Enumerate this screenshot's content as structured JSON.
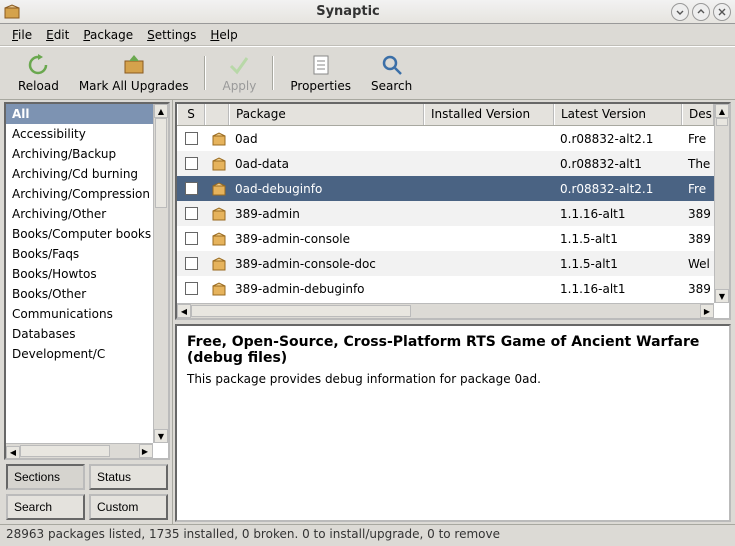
{
  "window": {
    "title": "Synaptic"
  },
  "menubar": [
    {
      "label": "File",
      "accel": "F"
    },
    {
      "label": "Edit",
      "accel": "E"
    },
    {
      "label": "Package",
      "accel": "P"
    },
    {
      "label": "Settings",
      "accel": "S"
    },
    {
      "label": "Help",
      "accel": "H"
    }
  ],
  "toolbar": {
    "reload": "Reload",
    "mark_all": "Mark All Upgrades",
    "apply": "Apply",
    "properties": "Properties",
    "search": "Search"
  },
  "categories": [
    "All",
    "Accessibility",
    "Archiving/Backup",
    "Archiving/Cd burning",
    "Archiving/Compression",
    "Archiving/Other",
    "Books/Computer books",
    "Books/Faqs",
    "Books/Howtos",
    "Books/Other",
    "Communications",
    "Databases",
    "Development/C"
  ],
  "categories_selected": 0,
  "left_buttons": {
    "sections": "Sections",
    "status": "Status",
    "search": "Search",
    "custom": "Custom"
  },
  "columns": {
    "s": "S",
    "package": "Package",
    "installed": "Installed Version",
    "latest": "Latest Version",
    "description": "Des"
  },
  "packages": [
    {
      "name": "0ad",
      "installed": "",
      "latest": "0.r08832-alt2.1",
      "desc": "Fre",
      "selected": false
    },
    {
      "name": "0ad-data",
      "installed": "",
      "latest": "0.r08832-alt1",
      "desc": "The",
      "selected": false
    },
    {
      "name": "0ad-debuginfo",
      "installed": "",
      "latest": "0.r08832-alt2.1",
      "desc": "Fre",
      "selected": true
    },
    {
      "name": "389-admin",
      "installed": "",
      "latest": "1.1.16-alt1",
      "desc": "389",
      "selected": false
    },
    {
      "name": "389-admin-console",
      "installed": "",
      "latest": "1.1.5-alt1",
      "desc": "389",
      "selected": false
    },
    {
      "name": "389-admin-console-doc",
      "installed": "",
      "latest": "1.1.5-alt1",
      "desc": "Wel",
      "selected": false
    },
    {
      "name": "389-admin-debuginfo",
      "installed": "",
      "latest": "1.1.16-alt1",
      "desc": "389",
      "selected": false
    }
  ],
  "description": {
    "title": "Free, Open-Source, Cross-Platform RTS Game of Ancient Warfare (debug files)",
    "body": "This package provides debug information for package 0ad."
  },
  "statusbar": "28963 packages listed, 1735 installed, 0 broken. 0 to install/upgrade, 0 to remove"
}
